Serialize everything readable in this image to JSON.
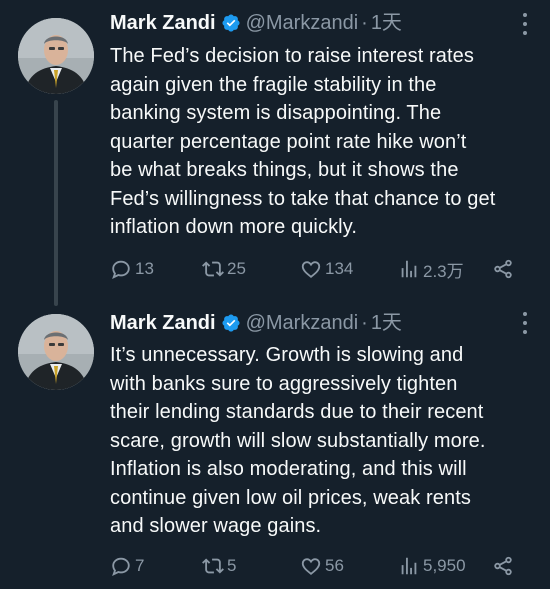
{
  "colors": {
    "background": "#15202b",
    "text": "#f7f9f9",
    "muted": "#8b98a5",
    "verified": "#1d9bf0",
    "thread_line": "#38444d"
  },
  "tweets": [
    {
      "author_name": "Mark Zandi",
      "handle": "@Markzandi",
      "separator": "·",
      "time": "1天",
      "text": "The Fed’s decision to raise interest rates\nagain given the fragile stability in the\nbanking system is disappointing. The\nquarter percentage point rate hike won’t\nbe what breaks things, but it shows the\nFed’s willingness to take that chance to get\ninflation down more quickly.",
      "replies": "13",
      "retweets": "25",
      "likes": "134",
      "views": "2.3万",
      "icons": [
        "verified-badge-icon",
        "more-options-icon",
        "reply-icon",
        "retweet-icon",
        "like-icon",
        "views-icon",
        "share-icon"
      ]
    },
    {
      "author_name": "Mark Zandi",
      "handle": "@Markzandi",
      "separator": "·",
      "time": "1天",
      "text": "It’s unnecessary. Growth is slowing and\nwith banks sure to aggressively tighten\ntheir lending standards due to their recent\nscare, growth will slow substantially more.\nInflation is also moderating, and this will\ncontinue given low oil prices, weak rents\nand slower wage gains.",
      "replies": "7",
      "retweets": "5",
      "likes": "56",
      "views": "5,950",
      "icons": [
        "verified-badge-icon",
        "more-options-icon",
        "reply-icon",
        "retweet-icon",
        "like-icon",
        "views-icon",
        "share-icon"
      ]
    }
  ]
}
